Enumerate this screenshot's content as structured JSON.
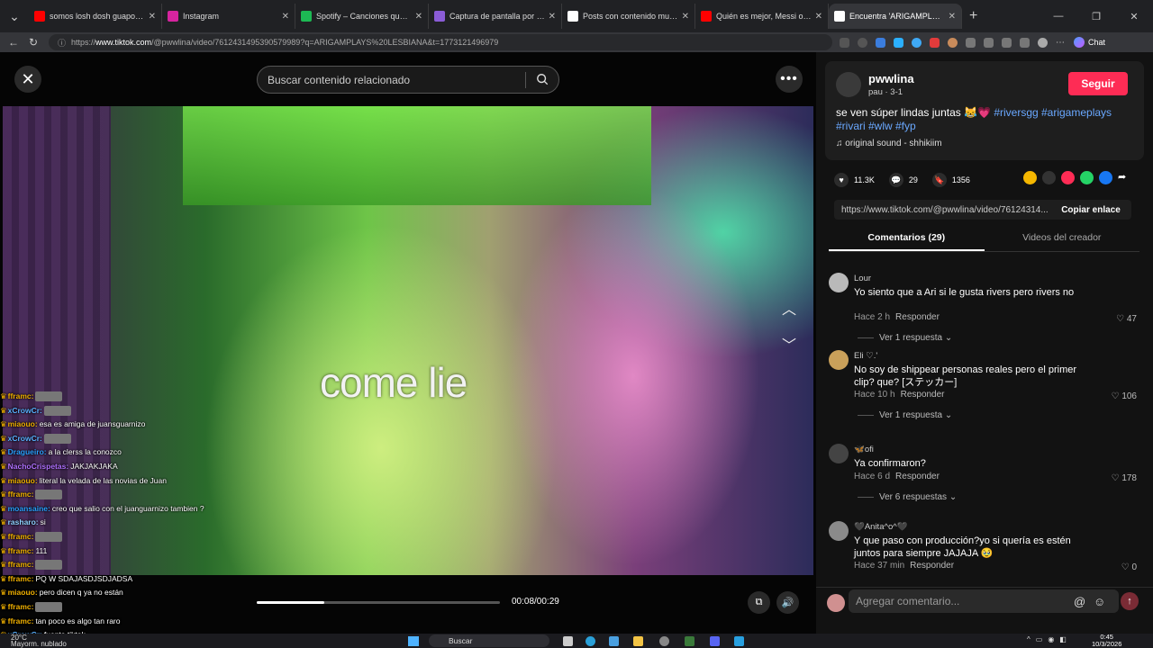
{
  "browser": {
    "tabs": [
      {
        "label": "somos losh dosh guapos 😍😂 Sh",
        "icon_color": "#ff0000",
        "active": false
      },
      {
        "label": "Instagram",
        "icon_color": "#d6249f",
        "active": false
      },
      {
        "label": "Spotify – Canciones que te gustan",
        "icon_color": "#1db954",
        "active": false
      },
      {
        "label": "Captura de pantalla por Lightshot",
        "icon_color": "#8a5cd6",
        "active": false
      },
      {
        "label": "Posts con contenido multimedia d",
        "icon_color": "#ffffff",
        "active": false
      },
      {
        "label": "Quién es mejor, Messi o tú - Cristi",
        "icon_color": "#ff0000",
        "active": false
      },
      {
        "label": "Encuentra 'ARIGAMPLAYS LE",
        "icon_color": "#ffffff",
        "active": true
      }
    ],
    "url_prefix": "https://",
    "url_host": "www.tiktok.com",
    "url_path": "/@pwwlina/video/7612431495390579989?q=ARIGAMPLAYS%20LESBIANA&t=1773121496979",
    "chat_label": "Chat"
  },
  "video": {
    "search_placeholder": "Buscar contenido relacionado",
    "caption": "come lie",
    "current_time": "00:08",
    "duration": "00:29",
    "timecode": "00:08/00:29",
    "progress_fraction": 0.276
  },
  "stream_chat": [
    {
      "user": "fframc:",
      "text": "",
      "color": "#f0b000",
      "emote": true
    },
    {
      "user": "xCrowCr:",
      "text": "",
      "color": "#5ab0ff",
      "emote": true
    },
    {
      "user": "miaouo:",
      "text": "esa es amiga de juansguarnizo",
      "color": "#f0b000",
      "emote": false
    },
    {
      "user": "xCrowCr:",
      "text": "",
      "color": "#5ab0ff",
      "emote": true
    },
    {
      "user": "Dragueiro:",
      "text": "a la clerss la conozco",
      "color": "#2aa0ff",
      "emote": false
    },
    {
      "user": "NachoCrispetas:",
      "text": "JAKJAKJAKA",
      "color": "#b070ff",
      "emote": false
    },
    {
      "user": "miaouo:",
      "text": "literal la velada de las novias de Juan",
      "color": "#f0b000",
      "emote": false
    },
    {
      "user": "fframc:",
      "text": "",
      "color": "#f0b000",
      "emote": true
    },
    {
      "user": "moansaine:",
      "text": "creo que salio con el juanguarnizo tambien ?",
      "color": "#2aa0ff",
      "emote": false
    },
    {
      "user": "rasharo:",
      "text": "si",
      "color": "#8fd0ff",
      "emote": false
    },
    {
      "user": "fframc:",
      "text": "",
      "color": "#f0b000",
      "emote": true
    },
    {
      "user": "fframc:",
      "text": "111",
      "color": "#f0b000",
      "emote": false
    },
    {
      "user": "fframc:",
      "text": "",
      "color": "#f0b000",
      "emote": true
    },
    {
      "user": "fframc:",
      "text": "PQ W SDAJASDJSDJADSA",
      "color": "#f0b000",
      "emote": false
    },
    {
      "user": "miaouo:",
      "text": "pero dicen q ya no están",
      "color": "#f0b000",
      "emote": false
    },
    {
      "user": "fframc:",
      "text": "",
      "color": "#f0b000",
      "emote": true
    },
    {
      "user": "fframc:",
      "text": "tan poco es algo tan raro",
      "color": "#f0b000",
      "emote": false
    },
    {
      "user": "xCrowCr:",
      "text": "fuente tiktok",
      "color": "#5ab0ff",
      "emote": false
    }
  ],
  "post": {
    "author": "pwwlina",
    "author_sub": "pau · 3-1",
    "follow_label": "Seguir",
    "description": "se ven súper lindas juntas 😹💗",
    "hashtags": "#riversgg #arigameplays #rivari #wlw #fyp",
    "sound": "original sound - shhikiim",
    "likes": "11.3K",
    "comments_count": "29",
    "saves": "1356",
    "share_link": "https://www.tiktok.com/@pwwlina/video/76124314...",
    "copy_label": "Copiar enlace",
    "tab_comments": "Comentarios (29)",
    "tab_creator": "Videos del creador"
  },
  "comments": [
    {
      "name": "Lour",
      "text": "Yo siento que a Ari si le gusta rivers pero rivers no",
      "time": "Hace 2 h",
      "reply": "Responder",
      "likes": "47",
      "more": "Ver 1 respuesta"
    },
    {
      "name": "Eli ♡.'",
      "text": "No soy de shippear personas reales pero el primer clip? que? [ステッカー]",
      "time": "Hace 10 h",
      "reply": "Responder",
      "likes": "106",
      "more": "Ver 1 respuesta"
    },
    {
      "name": "🦋ofi",
      "text": "Ya confirmaron?",
      "time": "Hace 6 d",
      "reply": "Responder",
      "likes": "178",
      "more": "Ver 6 respuestas"
    },
    {
      "name": "🖤Anita^o^🖤",
      "text": "Y que paso con producción?yo si quería es estén juntos para siempre JAJAJA 🥹",
      "time": "Hace 37 min",
      "reply": "Responder",
      "likes": "0",
      "more": ""
    }
  ],
  "composer": {
    "placeholder": "Agregar comentario..."
  },
  "taskbar": {
    "search_label": "Buscar",
    "left_line1": "20°C",
    "left_line2": "Mayorm. nublado",
    "time": "0:45",
    "date": "10/3/2026"
  }
}
